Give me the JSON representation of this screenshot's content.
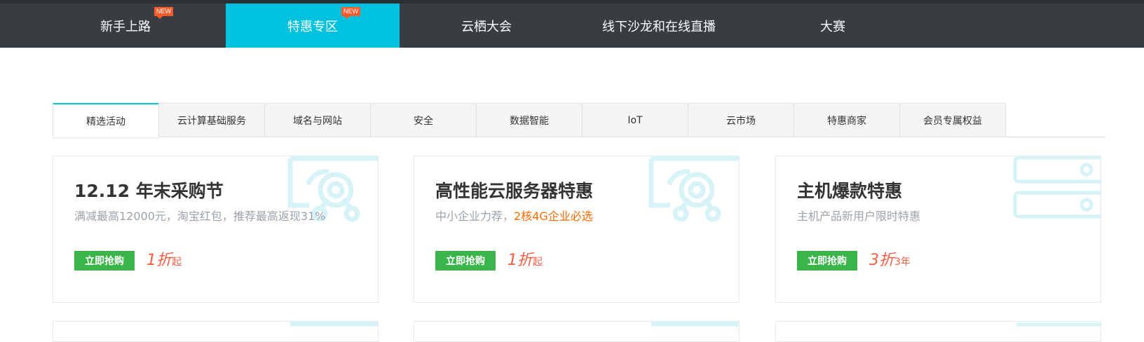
{
  "top_nav": {
    "items": [
      {
        "label": "新手上路",
        "badge": "NEW"
      },
      {
        "label": "特惠专区",
        "badge": "NEW",
        "active": true
      },
      {
        "label": "云栖大会"
      },
      {
        "label": "线下沙龙和在线直播"
      },
      {
        "label": "大赛"
      }
    ],
    "colors": {
      "background": "#373d41",
      "active": "#00c1de",
      "badge": "#ff5a2a"
    }
  },
  "category_tabs": [
    {
      "label": "精选活动",
      "active": true
    },
    {
      "label": "云计算基础服务"
    },
    {
      "label": "域名与网站"
    },
    {
      "label": "安全"
    },
    {
      "label": "数据智能"
    },
    {
      "label": "IoT"
    },
    {
      "label": "云市场"
    },
    {
      "label": "特惠商家"
    },
    {
      "label": "会员专属权益"
    }
  ],
  "cards": [
    {
      "title": "12.12 年末采购节",
      "desc": "满减最高12000元，淘宝红包，推荐最高返现31%",
      "desc_highlight": "",
      "button": "立即抢购",
      "price_big": "1折",
      "price_small": "起",
      "decoration_icon": "cloud-network-icon"
    },
    {
      "title": "高性能云服务器特惠",
      "desc": "中小企业力荐，",
      "desc_highlight": "2核4G企业必选",
      "button": "立即抢购",
      "price_big": "1折",
      "price_small": "起",
      "decoration_icon": "cloud-network-icon"
    },
    {
      "title": "主机爆款特惠",
      "desc": "主机产品新用户限时特惠",
      "desc_highlight": "",
      "button": "立即抢购",
      "price_big": "3折",
      "price_small": "3年",
      "decoration_icon": "server-rack-icon"
    }
  ],
  "colors": {
    "button": "#3ab54a",
    "price": "#f55d43",
    "highlight": "#ff6a00",
    "decoration": "#d8f3f7"
  }
}
